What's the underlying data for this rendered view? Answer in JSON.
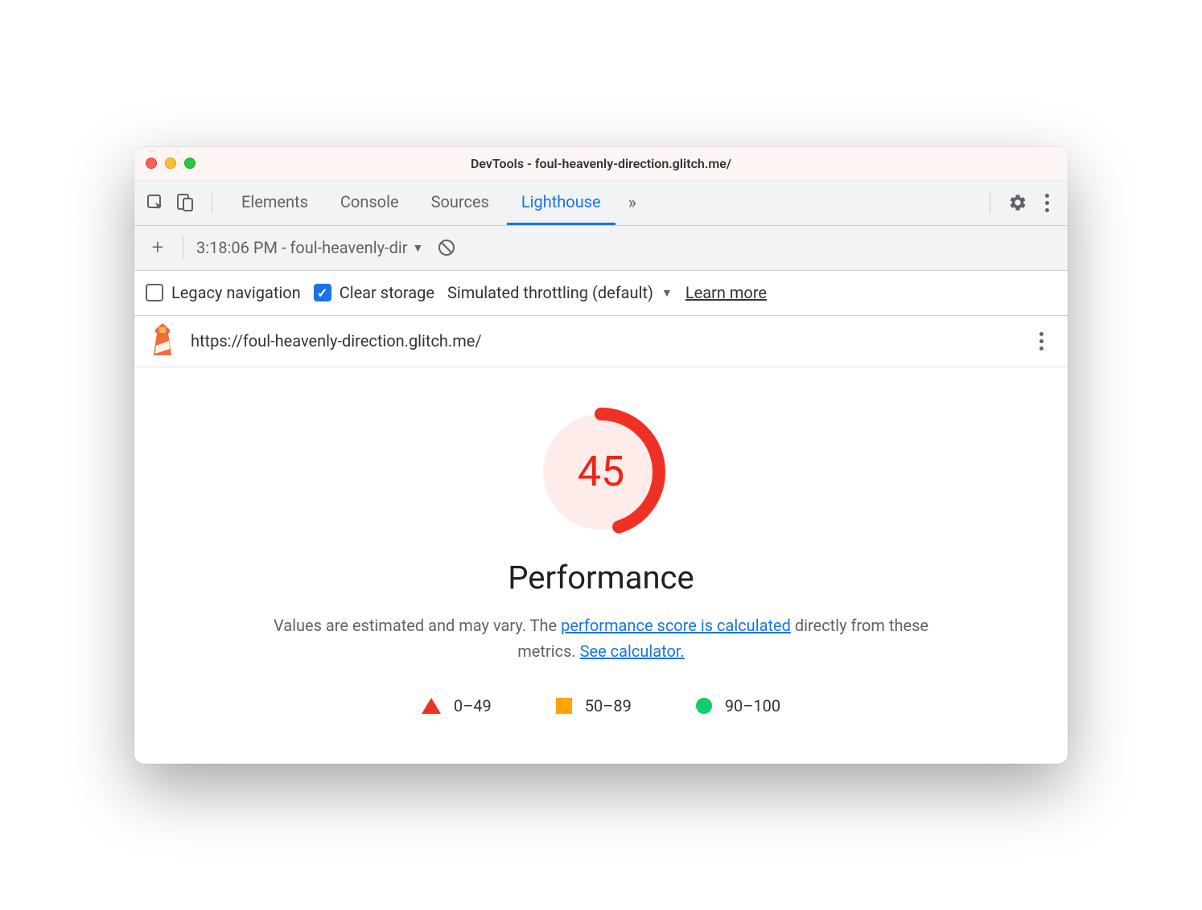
{
  "window": {
    "title": "DevTools - foul-heavenly-direction.glitch.me/"
  },
  "tabs": {
    "items": [
      "Elements",
      "Console",
      "Sources",
      "Lighthouse"
    ],
    "active": "Lighthouse"
  },
  "report_selector": {
    "label": "3:18:06 PM - foul-heavenly-dir"
  },
  "options": {
    "legacy_nav_label": "Legacy navigation",
    "legacy_nav_checked": false,
    "clear_storage_label": "Clear storage",
    "clear_storage_checked": true,
    "throttling_label": "Simulated throttling (default)",
    "learn_more_label": "Learn more"
  },
  "url_row": {
    "url": "https://foul-heavenly-direction.glitch.me/"
  },
  "report": {
    "score": "45",
    "score_pct": 45,
    "heading": "Performance",
    "desc_prefix": "Values are estimated and may vary. The ",
    "link1": "performance score is calculated",
    "desc_mid": " directly from these metrics. ",
    "link2": "See calculator.",
    "legend": {
      "range_poor": "0–49",
      "range_avg": "50–89",
      "range_good": "90–100"
    }
  },
  "colors": {
    "poor": "#ef3125",
    "avg": "#ffa400",
    "good": "#0cce6b",
    "link": "#1a73e8"
  }
}
